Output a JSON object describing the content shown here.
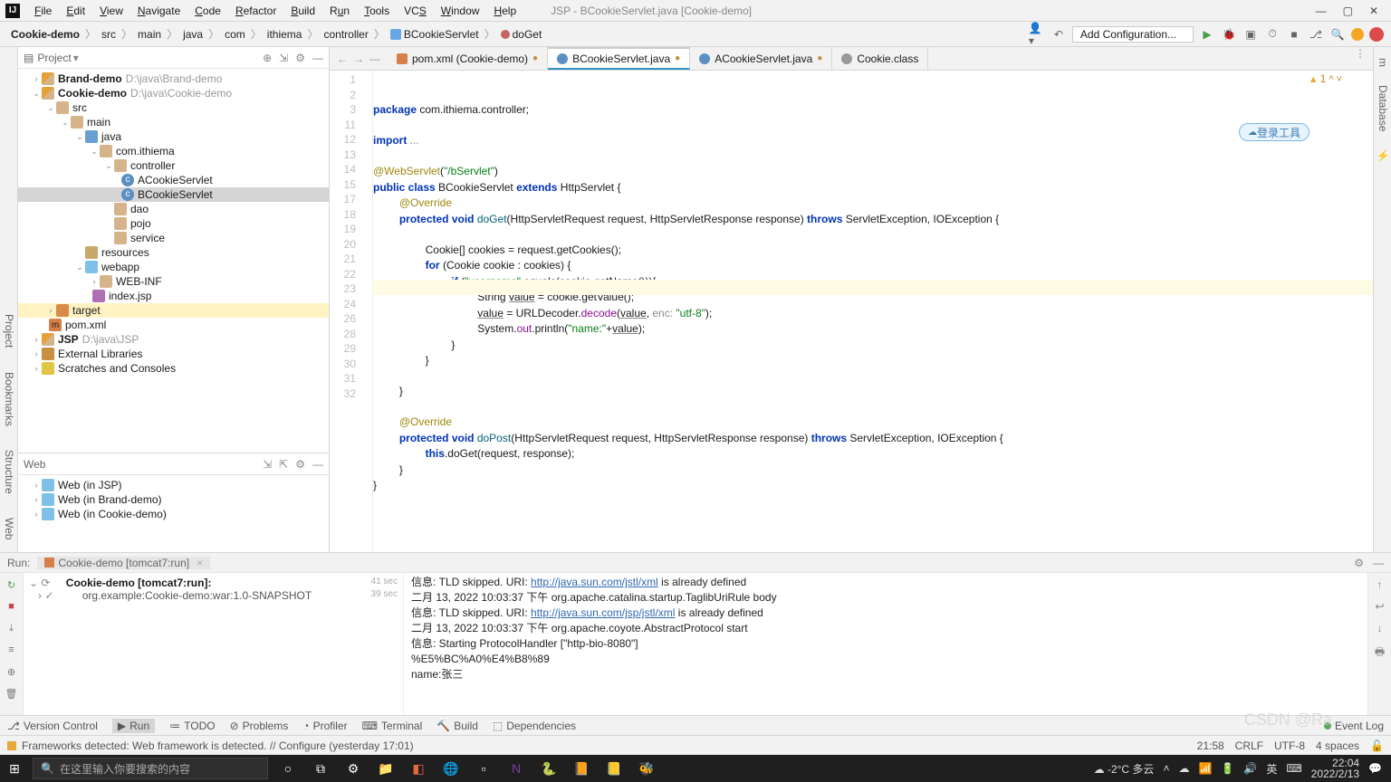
{
  "window_title": "JSP - BCookieServlet.java [Cookie-demo]",
  "menu": [
    "File",
    "Edit",
    "View",
    "Navigate",
    "Code",
    "Refactor",
    "Build",
    "Run",
    "Tools",
    "VCS",
    "Window",
    "Help"
  ],
  "breadcrumbs": {
    "project": "Cookie-demo",
    "parts": [
      "src",
      "main",
      "java",
      "com",
      "ithiema",
      "controller"
    ],
    "file": "BCookieServlet",
    "method": "doGet"
  },
  "run_config": "Add Configuration...",
  "project_panel": {
    "title": "Project",
    "nodes": {
      "brand": "Brand-demo",
      "brand_path": "D:\\java\\Brand-demo",
      "cookie": "Cookie-demo",
      "cookie_path": "D:\\java\\Cookie-demo",
      "src": "src",
      "main": "main",
      "java": "java",
      "pkg": "com.ithiema",
      "ctrl": "controller",
      "a": "ACookieServlet",
      "b": "BCookieServlet",
      "dao": "dao",
      "pojo": "pojo",
      "service": "service",
      "resources": "resources",
      "webapp": "webapp",
      "webinf": "WEB-INF",
      "index": "index.jsp",
      "target": "target",
      "pom": "pom.xml",
      "jsp": "JSP",
      "jsp_path": "D:\\java\\JSP",
      "ext": "External Libraries",
      "scr": "Scratches and Consoles"
    }
  },
  "web_panel": {
    "title": "Web",
    "items": [
      "Web (in JSP)",
      "Web (in Brand-demo)",
      "Web (in Cookie-demo)"
    ]
  },
  "editor_tabs": [
    {
      "label": "pom.xml (Cookie-demo)",
      "type": "xml"
    },
    {
      "label": "BCookieServlet.java",
      "type": "cls"
    },
    {
      "label": "ACookieServlet.java",
      "type": "cls"
    },
    {
      "label": "Cookie.class",
      "type": "clsg"
    }
  ],
  "line_numbers": [
    1,
    2,
    3,
    "",
    11,
    12,
    13,
    14,
    15,
    "",
    17,
    18,
    19,
    20,
    21,
    22,
    23,
    24,
    "",
    26,
    "",
    28,
    29,
    30,
    31,
    32
  ],
  "code": {
    "l1a": "package",
    "l1b": " com.ithiema.controller;",
    "l3a": "import",
    "l3b": " ...",
    "l5": "@WebServlet",
    "l5b": "(",
    "l5c": "\"/bServlet\"",
    "l5d": ")",
    "l6a": "public class",
    "l6b": " BCookieServlet ",
    "l6c": "extends",
    "l6d": " HttpServlet {",
    "l7": "@Override",
    "l8a": "protected void",
    "l8b": " doGet",
    "l8c": "(HttpServletRequest request, HttpServletResponse response) ",
    "l8d": "throws",
    "l8e": " ServletException, IOException {",
    "l10": "Cookie[] cookies = request.getCookies();",
    "l11a": "for",
    "l11b": " (Cookie cookie : cookies) {",
    "l12a": "if",
    "l12b": " (",
    "l12c": "\"username\"",
    "l12d": ".equals(cookie.getName())){",
    "l13a": "String ",
    "l13b": "value",
    "l13c": " = cookie.getValue();",
    "l14a": "value",
    "l14b": " = URLDecoder.",
    "l14c": "decode",
    "l14d": "(",
    "l14e": "value",
    "l14f": ", ",
    "l14g": "enc:",
    "l14h": " \"utf-8\"",
    "l14i": ");",
    "l15a": "System.",
    "l15b": "out",
    "l15c": ".println(",
    "l15d": "\"name:\"",
    "l15e": "+",
    "l15f": "value",
    "l15g": ");",
    "l16": "}",
    "l17": "}",
    "l19": "}",
    "l21": "@Override",
    "l22a": "protected void",
    "l22b": " doPost",
    "l22c": "(HttpServletRequest request, HttpServletResponse response) ",
    "l22d": "throws",
    "l22e": " ServletException, IOException {",
    "l23a": "this",
    "l23b": ".doGet(request, response);",
    "l24": "}",
    "l25": "}"
  },
  "warn_count": "1",
  "float_label": "登录工具",
  "console": {
    "title": "Run:",
    "tab": "Cookie-demo [tomcat7:run]",
    "tree_head": "Cookie-demo [tomcat7:run]:",
    "tree_sub": "org.example:Cookie-demo:war:1.0-SNAPSHOT",
    "t1": "41 sec",
    "t2": "39 sec",
    "out": [
      {
        "pre": "信息: TLD skipped. URI: ",
        "url": "http://java.sun.com/jstl/xml",
        "post": " is already defined"
      },
      {
        "plain": "二月 13, 2022 10:03:37 下午 org.apache.catalina.startup.TaglibUriRule body"
      },
      {
        "pre": "信息: TLD skipped. URI: ",
        "url": "http://java.sun.com/jsp/jstl/xml",
        "post": " is already defined"
      },
      {
        "plain": "二月 13, 2022 10:03:37 下午 org.apache.coyote.AbstractProtocol start"
      },
      {
        "plain": "信息: Starting ProtocolHandler [\"http-bio-8080\"]"
      },
      {
        "plain": "%E5%BC%A0%E4%B8%89"
      },
      {
        "plain": "name:张三"
      }
    ]
  },
  "bottom_tools": [
    "Version Control",
    "Run",
    "TODO",
    "Problems",
    "Profiler",
    "Terminal",
    "Build",
    "Dependencies"
  ],
  "event_log": "Event Log",
  "status_msg": "Frameworks detected: Web framework is detected. // Configure (yesterday 17:01)",
  "status_right": [
    "21:58",
    "CRLF",
    "UTF-8",
    "4 spaces"
  ],
  "taskbar": {
    "search_ph": "在这里输入你要搜索的内容",
    "weather": "-2°C 多云",
    "time": "22:04",
    "date": "2022/2/13"
  },
  "watermark": "CSDN @Ra..."
}
